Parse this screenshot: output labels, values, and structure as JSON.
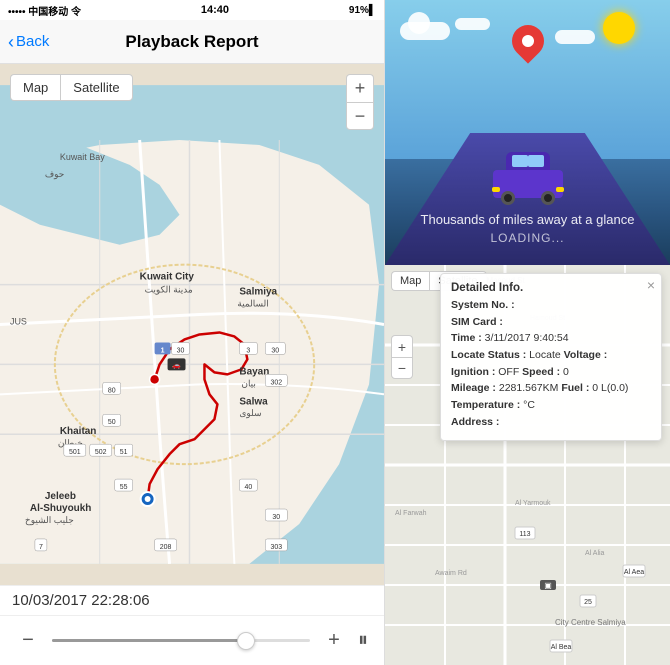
{
  "app": {
    "status_bar": {
      "left": "••••• 中国移动 令",
      "center": "14:40",
      "right": "91%▌"
    },
    "header": {
      "back_label": "Back",
      "title": "Playback Report"
    }
  },
  "left_panel": {
    "map_type_buttons": [
      {
        "label": "Map",
        "active": true
      },
      {
        "label": "Satellite",
        "active": false
      }
    ],
    "zoom_plus": "+",
    "zoom_minus": "−",
    "timestamp": "10/03/2017 22:28:06",
    "controls": {
      "minus_label": "−",
      "plus_label": "+",
      "pause_label": "⏸"
    }
  },
  "right_panel": {
    "illustration": {
      "tagline": "Thousands of miles away at a glance",
      "loading": "LOADING..."
    },
    "map_type_buttons": [
      {
        "label": "Map",
        "active": true
      },
      {
        "label": "Satellite",
        "active": false
      }
    ],
    "detail_popup": {
      "title": "Detailed Info.",
      "rows": [
        {
          "label": "System No. :",
          "value": ""
        },
        {
          "label": "SIM Card :",
          "value": ""
        },
        {
          "label": "Time :",
          "value": "3/11/2017 9:40:54"
        },
        {
          "label": "Locate Status :",
          "value": "Locate Voltage :"
        },
        {
          "label": "Ignition :",
          "value": "OFF Speed : 0"
        },
        {
          "label": "Mileage :",
          "value": "2281.567KM Fuel : 0 L(0.0)"
        },
        {
          "label": "Temperature :",
          "value": "°C"
        },
        {
          "label": "Address :",
          "value": ""
        }
      ]
    }
  }
}
